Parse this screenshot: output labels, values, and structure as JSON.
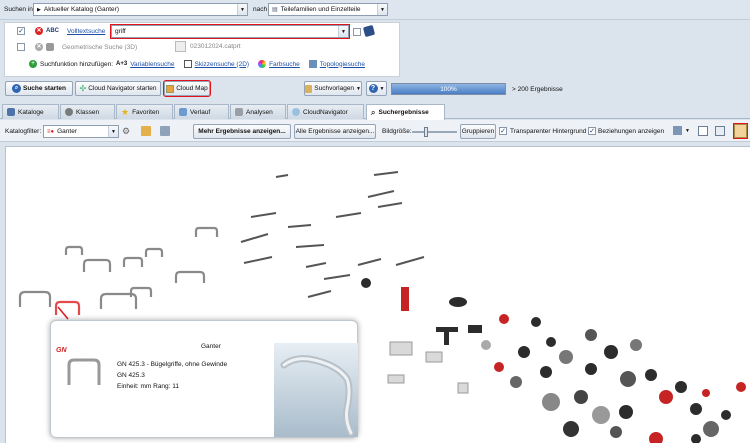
{
  "search_bar": {
    "search_in_label": "Suchen in",
    "catalog_value": "Aktueller Katalog (Ganter)",
    "after_label": "nach",
    "target_value": "Teilefamilien und Einzelteile"
  },
  "search_panel": {
    "fulltext": {
      "abc": "ABC",
      "label": "Volltextsuche",
      "value": "griff"
    },
    "geometric": {
      "label": "Geometrische Suche (3D)",
      "file": "023012024.catprt"
    },
    "add_function": {
      "label": "Suchfunktion hinzufügen:",
      "var_prefix": "A+3",
      "variable": "Variablensuche",
      "sketch": "Skizzensuche (2D)",
      "color": "Farbsuche",
      "topology": "Topologiesuche"
    }
  },
  "actions": {
    "start_search": "Suche starten",
    "cloud_navigator": "Cloud Navigator starten",
    "cloud_map": "Cloud Map",
    "templates": "Suchvorlagen",
    "help": "?",
    "progress_text": "100%",
    "progress_value": 100,
    "results": "> 200 Ergebnisse"
  },
  "tabs": [
    {
      "label": "Kataloge"
    },
    {
      "label": "Klassen"
    },
    {
      "label": "Favoriten"
    },
    {
      "label": "Verlauf"
    },
    {
      "label": "Analysen"
    },
    {
      "label": "CloudNavigator"
    },
    {
      "label": "Suchergebnisse"
    }
  ],
  "toolbar": {
    "catalog_filter_label": "Katalogfilter:",
    "catalog_filter_value": "Ganter",
    "more_results": "Mehr Ergebnisse anzeigen...",
    "all_results": "Alle Ergebnisse anzeigen...",
    "image_size": "Bildgröße:",
    "group": "Gruppieren",
    "transparent_bg": "Transparenter Hintergrund",
    "show_relations": "Beziehungen anzeigen"
  },
  "tooltip": {
    "vendor": "Ganter",
    "logo_text": "GN",
    "line1": "GN 425.3 - Bügelgriffe, ohne Gewinde",
    "line2": "GN 425.3",
    "line3": "Einheit: mm Rang: 11"
  },
  "colors": {
    "accent_red": "#e2141b",
    "progress_blue": "#4a7ec4",
    "brand_red": "#d42222"
  }
}
